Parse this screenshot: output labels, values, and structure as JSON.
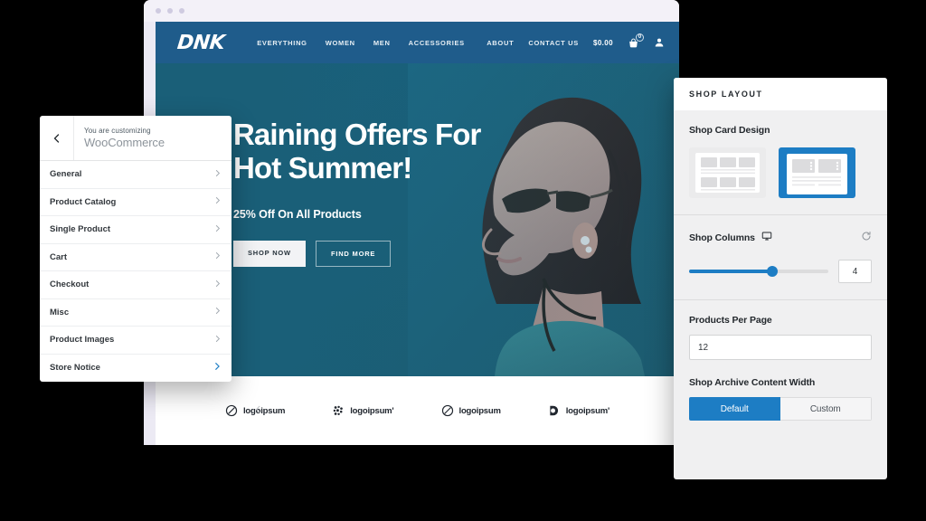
{
  "browser": {
    "dots": [
      "dot-1",
      "dot-2",
      "dot-3"
    ]
  },
  "site": {
    "logo": "DNK",
    "nav_left": [
      {
        "label": "EVERYTHING"
      },
      {
        "label": "WOMEN"
      },
      {
        "label": "MEN"
      },
      {
        "label": "ACCESSORIES"
      }
    ],
    "nav_right": [
      {
        "label": "ABOUT"
      },
      {
        "label": "CONTACT US"
      }
    ],
    "cart_price": "$0.00",
    "cart_count": "0",
    "hero": {
      "title": "Raining Offers For\nHot Summer!",
      "subtitle": "25% Off On All Products",
      "primary_button": "SHOP NOW",
      "secondary_button": "FIND MORE"
    },
    "logo_strip": [
      {
        "name": "logoipsum",
        "mark": "circle-slash-icon"
      },
      {
        "name": "logoipsum'",
        "mark": "dot-cluster-icon"
      },
      {
        "name": "logoipsum",
        "mark": "circle-slash-icon"
      },
      {
        "name": "logoipsum'",
        "mark": "half-disc-icon"
      }
    ]
  },
  "customizer": {
    "back_icon": "chevron-left-icon",
    "kicker": "You are customizing",
    "name": "WooCommerce",
    "items": [
      {
        "label": "General",
        "active": false
      },
      {
        "label": "Product Catalog",
        "active": false
      },
      {
        "label": "Single Product",
        "active": false
      },
      {
        "label": "Cart",
        "active": false
      },
      {
        "label": "Checkout",
        "active": false
      },
      {
        "label": "Misc",
        "active": false
      },
      {
        "label": "Product Images",
        "active": false
      },
      {
        "label": "Store Notice",
        "active": true
      }
    ]
  },
  "shop_panel": {
    "title": "SHOP LAYOUT",
    "card_design": {
      "label": "Shop Card Design",
      "options": [
        {
          "name": "grid-card-design",
          "selected": false
        },
        {
          "name": "list-card-design",
          "selected": true
        }
      ]
    },
    "shop_columns": {
      "label": "Shop Columns",
      "device_icon": "monitor-icon",
      "reset_icon": "reset-icon",
      "value": "4",
      "fill_percent": 60
    },
    "products_per_page": {
      "label": "Products Per Page",
      "value": "12"
    },
    "archive_width": {
      "label": "Shop Archive Content Width",
      "options": [
        {
          "label": "Default",
          "selected": true
        },
        {
          "label": "Custom",
          "selected": false
        }
      ]
    }
  },
  "colors": {
    "accent": "#1d7dc4",
    "header_blue": "#1f5c8b",
    "hero_teal": "#1a5f78"
  }
}
